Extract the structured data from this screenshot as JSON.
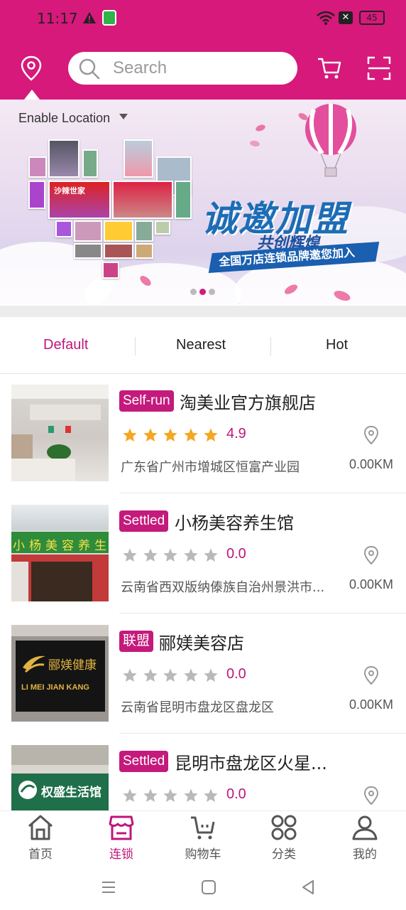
{
  "status": {
    "time": "11:17",
    "battery": "45"
  },
  "header": {
    "search_placeholder": "Search"
  },
  "location": {
    "label": "Enable Location"
  },
  "banner": {
    "headline": "诚邀加盟",
    "subline": "共创辉煌",
    "ribbon": "全国万店连锁品牌邀您加入",
    "shop_sign": "沙辣世家",
    "dots": 3,
    "active_dot": 1
  },
  "tabs": [
    {
      "label": "Default",
      "active": true
    },
    {
      "label": "Nearest",
      "active": false
    },
    {
      "label": "Hot",
      "active": false
    }
  ],
  "stores": [
    {
      "badge": "Self-run",
      "name": "淘美业官方旗舰店",
      "rating": "4.9",
      "stars_filled": 5,
      "address": "广东省广州市增城区恒富产业园",
      "distance": "0.00KM"
    },
    {
      "badge": "Settled",
      "name": "小杨美容养生馆",
      "rating": "0.0",
      "stars_filled": 0,
      "address": "云南省西双版纳傣族自治州景洪市...",
      "distance": "0.00KM",
      "photo_sign": "小杨美容养生"
    },
    {
      "badge": "联盟",
      "name": "郦媄美容店",
      "rating": "0.0",
      "stars_filled": 0,
      "address": "云南省昆明市盘龙区盘龙区",
      "distance": "0.00KM",
      "photo_sign_cn": "郦媄健康",
      "photo_sign_en": "LI MEI JIAN KANG"
    },
    {
      "badge": "Settled",
      "name": "昆明市盘龙区火星...",
      "rating": "0.0",
      "stars_filled": 0,
      "address": "",
      "distance": "",
      "photo_sign": "权盛生活馆"
    }
  ],
  "bottom_nav": [
    {
      "label": "首页",
      "icon": "home-icon",
      "active": false
    },
    {
      "label": "连锁",
      "icon": "store-icon",
      "active": true
    },
    {
      "label": "购物车",
      "icon": "cart-icon",
      "active": false
    },
    {
      "label": "分类",
      "icon": "category-icon",
      "active": false
    },
    {
      "label": "我的",
      "icon": "user-icon",
      "active": false
    }
  ],
  "colors": {
    "brand": "#d6197a",
    "accent_text": "#c0157c",
    "star_active": "#f5a623",
    "star_inactive": "#b9b9b9"
  }
}
